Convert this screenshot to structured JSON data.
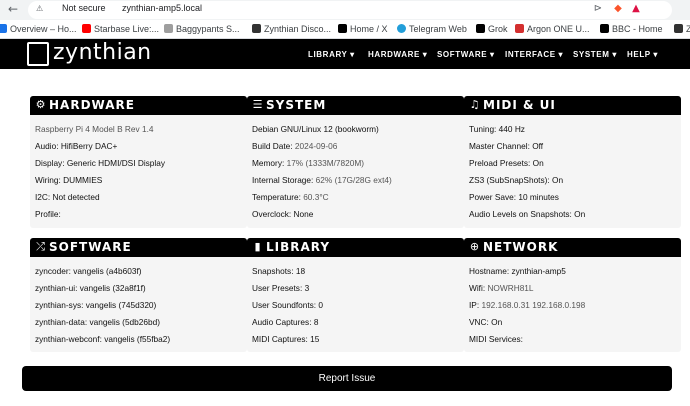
{
  "browser": {
    "not_secure": "Not secure",
    "url": "zynthian-amp5.local",
    "bookmarks": [
      {
        "label": "Overview – Ho...",
        "color": "#1a73e8"
      },
      {
        "label": "Starbase Live:...",
        "color": "#ff0000"
      },
      {
        "label": "Baggypants S...",
        "color": "#9e9e9e"
      },
      {
        "label": "Zynthian Disco...",
        "color": "#333333"
      },
      {
        "label": "Home / X",
        "color": "#000000"
      },
      {
        "label": "Telegram Web",
        "color": "#229ed9"
      },
      {
        "label": "Grok",
        "color": "#000000"
      },
      {
        "label": "Argon ONE U...",
        "color": "#d32f2f"
      },
      {
        "label": "BBC - Home",
        "color": "#000000"
      },
      {
        "label": "Z",
        "color": "#333333"
      }
    ]
  },
  "app": {
    "logo": "zynthian",
    "menu": [
      "LIBRARY ▾",
      "HARDWARE ▾",
      "SOFTWARE ▾",
      "INTERFACE ▾",
      "SYSTEM ▾",
      "HELP ▾"
    ]
  },
  "panels": {
    "hardware": {
      "title": "HARDWARE",
      "rows": [
        {
          "label": "",
          "value": "Raspberry Pi 4 Model B Rev 1.4"
        },
        {
          "label": "Audio: ",
          "value": "HifiBerry DAC+"
        },
        {
          "label": "Display: ",
          "value": "Generic HDMI/DSI Display"
        },
        {
          "label": "Wiring: ",
          "value": "DUMMIES"
        },
        {
          "label": "I2C: ",
          "value": "Not detected"
        },
        {
          "label": "Profile:",
          "value": ""
        }
      ]
    },
    "system": {
      "title": "SYSTEM",
      "rows": [
        {
          "label": "Debian GNU/Linux 12 (bookworm)",
          "value": ""
        },
        {
          "label": "Build Date: ",
          "value": "2024-09-06"
        },
        {
          "label": "Memory: ",
          "value": "17% (1333M/7820M)"
        },
        {
          "label": "Internal Storage: ",
          "value": "62% (17G/28G ext4)"
        },
        {
          "label": "Temperature: ",
          "value": "60.3°C"
        },
        {
          "label": "Overclock: ",
          "value": "None"
        }
      ]
    },
    "midi": {
      "title": "MIDI & UI",
      "rows": [
        {
          "label": "Tuning: ",
          "value": "440 Hz"
        },
        {
          "label": "Master Channel: ",
          "value": "Off"
        },
        {
          "label": "Preload Presets: ",
          "value": "On"
        },
        {
          "label": "ZS3 (SubSnapShots): ",
          "value": "On"
        },
        {
          "label": "Power Save: ",
          "value": "10 minutes"
        },
        {
          "label": "Audio Levels on Snapshots: ",
          "value": "On"
        }
      ]
    },
    "software": {
      "title": "SOFTWARE",
      "rows": [
        {
          "label": "zyncoder: ",
          "value": "vangelis (a4b603f)"
        },
        {
          "label": "zynthian-ui: ",
          "value": "vangelis (32a8f1f)"
        },
        {
          "label": "zynthian-sys: ",
          "value": "vangelis (745d320)"
        },
        {
          "label": "zynthian-data: ",
          "value": "vangelis (5db26bd)"
        },
        {
          "label": "zynthian-webconf: ",
          "value": "vangelis (f55fba2)"
        }
      ]
    },
    "library": {
      "title": "LIBRARY",
      "rows": [
        {
          "label": "Snapshots: ",
          "value": "18"
        },
        {
          "label": "User Presets: ",
          "value": "3"
        },
        {
          "label": "User Soundfonts: ",
          "value": "0"
        },
        {
          "label": "Audio Captures: ",
          "value": "8"
        },
        {
          "label": "MIDI Captures: ",
          "value": "15"
        }
      ]
    },
    "network": {
      "title": "NETWORK",
      "rows": [
        {
          "label": "Hostname: ",
          "value": "zynthian-amp5"
        },
        {
          "label": "Wifi: ",
          "value": "NOWRH81L"
        },
        {
          "label": "IP: ",
          "value": "192.168.0.31 192.168.0.198"
        },
        {
          "label": "VNC: ",
          "value": "On"
        },
        {
          "label": "MIDI Services:",
          "value": ""
        }
      ]
    }
  },
  "report_button": "Report Issue"
}
